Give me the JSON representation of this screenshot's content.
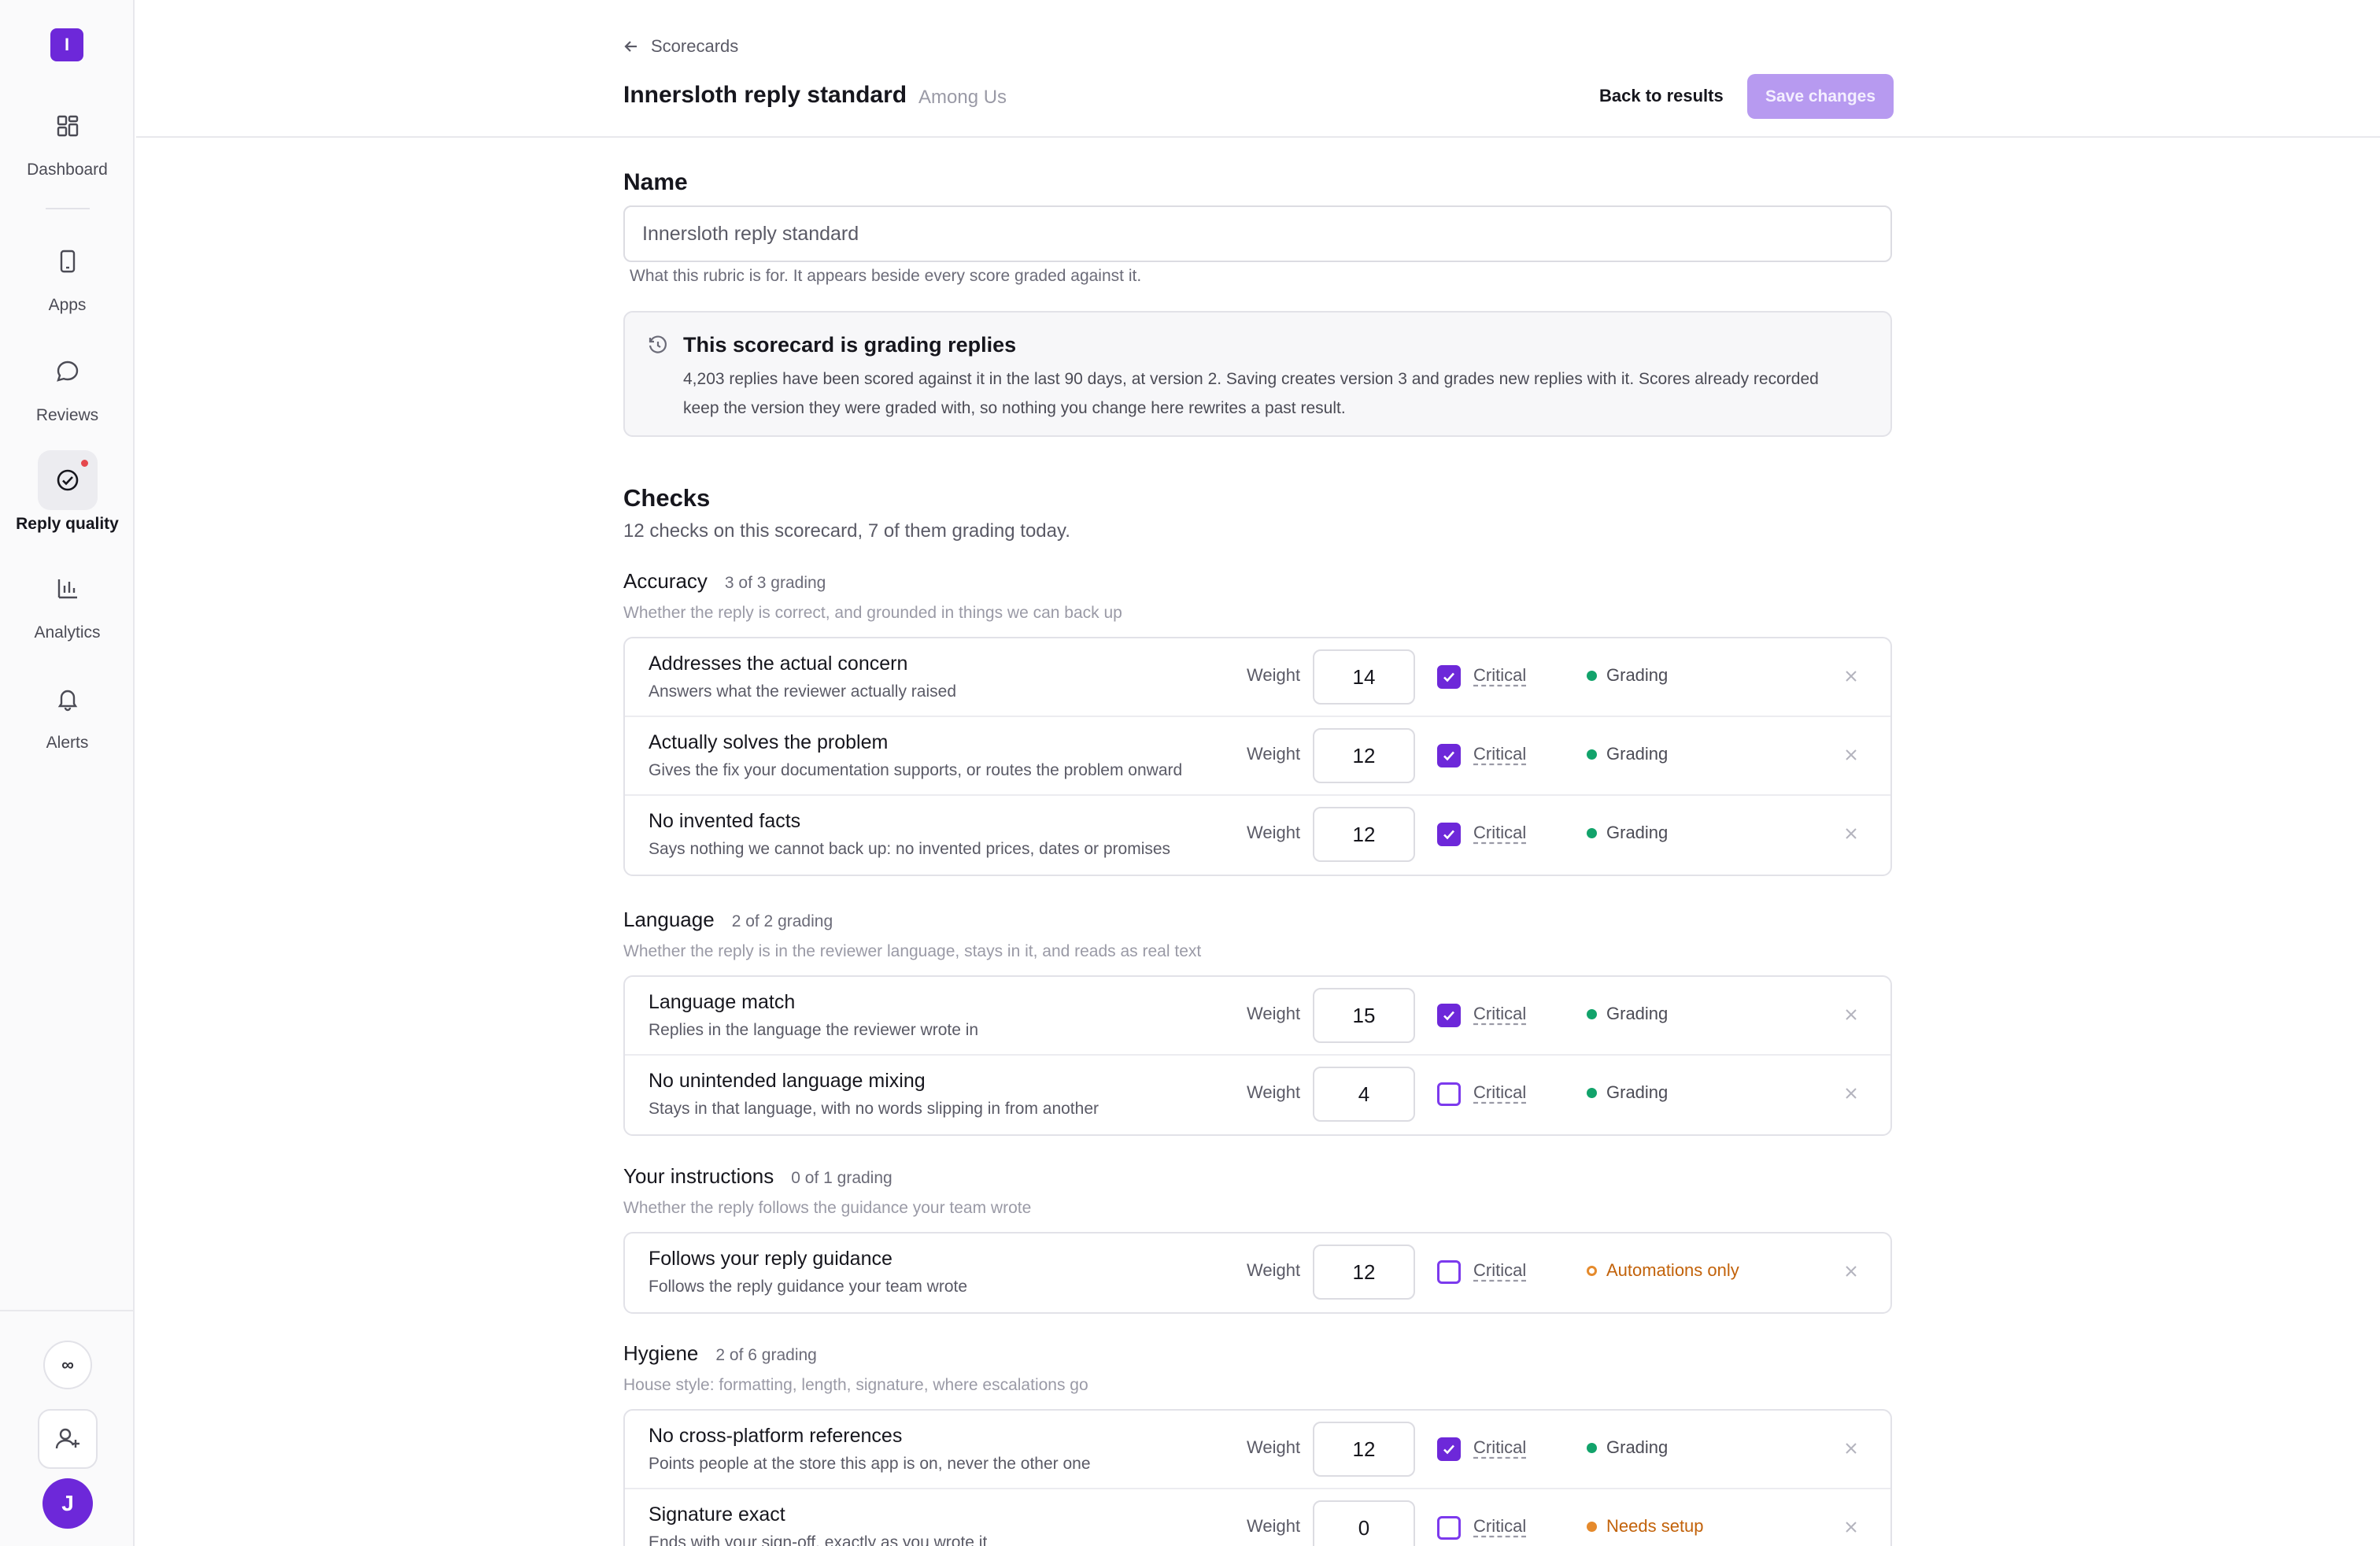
{
  "sidebar": {
    "logo": "I",
    "items": [
      {
        "label": "Dashboard",
        "icon": "grid-icon"
      },
      {
        "label": "Apps",
        "icon": "phone-icon"
      },
      {
        "label": "Reviews",
        "icon": "chat-bubble-icon"
      },
      {
        "label": "Reply quality",
        "icon": "check-circle-icon",
        "active": true
      },
      {
        "label": "Analytics",
        "icon": "bar-chart-icon"
      },
      {
        "label": "Alerts",
        "icon": "bell-icon"
      }
    ],
    "infinity": "∞",
    "avatar": "J"
  },
  "header": {
    "breadcrumb": "Scorecards",
    "title": "Innersloth reply standard",
    "subtitle": "Among Us",
    "back_label": "Back to results",
    "save_label": "Save changes"
  },
  "name_section": {
    "heading": "Name",
    "value": "Innersloth reply standard",
    "help": "What this rubric is for. It appears beside every score graded against it."
  },
  "info": {
    "title": "This scorecard is grading replies",
    "body": "4,203 replies have been scored against it in the last 90 days, at version 2. Saving creates version 3 and grades new replies with it. Scores already recorded keep the version they were graded with, so nothing you change here rewrites a past result."
  },
  "checks": {
    "heading": "Checks",
    "summary": "12 checks on this scorecard, 7 of them grading today.",
    "weight_label": "Weight",
    "critical_label": "Critical",
    "groups": [
      {
        "name": "Accuracy",
        "count": "3 of 3 grading",
        "desc": "Whether the reply is correct, and grounded in things we can back up",
        "rows": [
          {
            "title": "Addresses the actual concern",
            "desc": "Answers what the reviewer actually raised",
            "weight": "14",
            "critical": true,
            "status": "Grading"
          },
          {
            "title": "Actually solves the problem",
            "desc": "Gives the fix your documentation supports, or routes the problem onward",
            "weight": "12",
            "critical": true,
            "status": "Grading"
          },
          {
            "title": "No invented facts",
            "desc": "Says nothing we cannot back up: no invented prices, dates or promises",
            "weight": "12",
            "critical": true,
            "status": "Grading"
          }
        ]
      },
      {
        "name": "Language",
        "count": "2 of 2 grading",
        "desc": "Whether the reply is in the reviewer language, stays in it, and reads as real text",
        "rows": [
          {
            "title": "Language match",
            "desc": "Replies in the language the reviewer wrote in",
            "weight": "15",
            "critical": true,
            "status": "Grading"
          },
          {
            "title": "No unintended language mixing",
            "desc": "Stays in that language, with no words slipping in from another",
            "weight": "4",
            "critical": false,
            "status": "Grading"
          }
        ]
      },
      {
        "name": "Your instructions",
        "count": "0 of 1 grading",
        "desc": "Whether the reply follows the guidance your team wrote",
        "rows": [
          {
            "title": "Follows your reply guidance",
            "desc": "Follows the reply guidance your team wrote",
            "weight": "12",
            "critical": false,
            "status": "Automations only"
          }
        ]
      },
      {
        "name": "Hygiene",
        "count": "2 of 6 grading",
        "desc": "House style: formatting, length, signature, where escalations go",
        "rows": [
          {
            "title": "No cross-platform references",
            "desc": "Points people at the store this app is on, never the other one",
            "weight": "12",
            "critical": true,
            "status": "Grading"
          },
          {
            "title": "Signature exact",
            "desc": "Ends with your sign-off, exactly as you wrote it",
            "weight": "0",
            "critical": false,
            "status": "Needs setup"
          }
        ]
      }
    ]
  }
}
